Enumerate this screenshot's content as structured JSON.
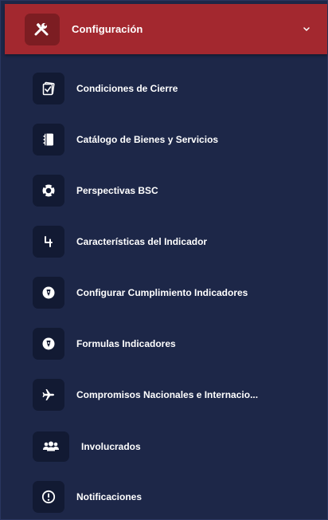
{
  "menu": {
    "header": {
      "label": "Configuración",
      "icon": "tools-icon",
      "expand_icon": "chevron-down-icon",
      "colors": {
        "background": "#a3282f",
        "icon_box": "#7c1d22"
      }
    },
    "items": [
      {
        "label": "Condiciones de Cierre",
        "icon": "checklist-icon"
      },
      {
        "label": "Catálogo de Bienes y Servicios",
        "icon": "notebook-icon"
      },
      {
        "label": "Perspectivas BSC",
        "icon": "life-ring-icon"
      },
      {
        "label": "Características del Indicador",
        "icon": "number-four-icon"
      },
      {
        "label": "Configurar Cumplimiento Indicadores",
        "icon": "pen-nib-icon"
      },
      {
        "label": "Formulas Indicadores",
        "icon": "pen-nib-icon"
      },
      {
        "label": "Compromisos Nacionales e Internacio...",
        "icon": "plane-icon"
      },
      {
        "label": "Involucrados",
        "icon": "users-icon"
      },
      {
        "label": "Notificaciones",
        "icon": "alert-circle-icon"
      }
    ],
    "colors": {
      "sidebar_bg": "#1d2748",
      "icon_box": "#121a33",
      "text": "#ffffff"
    }
  }
}
